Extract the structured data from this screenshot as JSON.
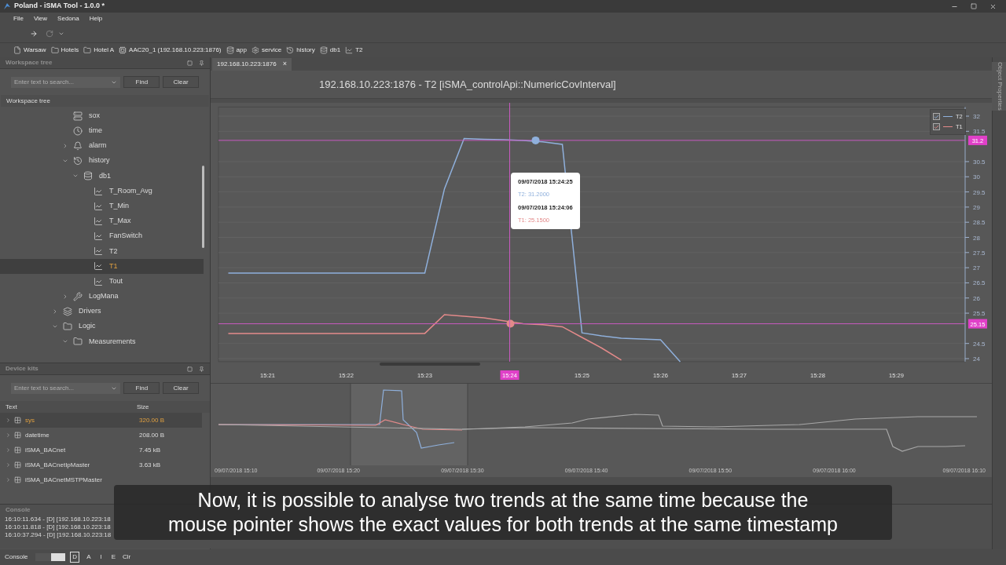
{
  "window": {
    "title": "Poland - iSMA Tool - 1.0.0 *"
  },
  "menu": [
    "File",
    "View",
    "Sedona",
    "Help"
  ],
  "breadcrumb": [
    {
      "label": "Warsaw",
      "kind": "file"
    },
    {
      "label": "Hotels",
      "kind": "folder"
    },
    {
      "label": "Hotel A",
      "kind": "folder"
    },
    {
      "label": "AAC20_1 (192.168.10.223:1876)",
      "kind": "device"
    },
    {
      "label": "app",
      "kind": "database"
    },
    {
      "label": "service",
      "kind": "gear"
    },
    {
      "label": "history",
      "kind": "history"
    },
    {
      "label": "db1",
      "kind": "database"
    },
    {
      "label": "T2",
      "kind": "trend"
    }
  ],
  "workspace": {
    "title": "Workspace tree",
    "search": {
      "placeholder": "Enter text to search..."
    },
    "find": "Find",
    "clear": "Clear",
    "column": "Workspace tree",
    "tree": {
      "continued": [
        {
          "label": "sox",
          "kind": "service",
          "selected": false
        },
        {
          "label": "time",
          "kind": "clock",
          "selected": false
        },
        {
          "label": "alarm",
          "kind": "alarm",
          "expanded": false,
          "selected": false
        },
        {
          "label": "history",
          "kind": "history",
          "expanded": true,
          "selected": false,
          "children": [
            {
              "label": "db1",
              "kind": "database",
              "expanded": true,
              "selected": false,
              "children": [
                {
                  "label": "T_Room_Avg",
                  "kind": "trend",
                  "selected": false
                },
                {
                  "label": "T_Min",
                  "kind": "trend",
                  "selected": false
                },
                {
                  "label": "T_Max",
                  "kind": "trend",
                  "selected": false
                },
                {
                  "label": "FanSwitch",
                  "kind": "trend",
                  "selected": false
                },
                {
                  "label": "T2",
                  "kind": "trend",
                  "selected": false
                },
                {
                  "label": "T1",
                  "kind": "trend",
                  "selected": true
                },
                {
                  "label": "Tout",
                  "kind": "trend",
                  "selected": false
                }
              ]
            }
          ]
        },
        {
          "label": "LogMana",
          "kind": "tool",
          "expanded": false,
          "selected": false
        }
      ],
      "items": [
        {
          "label": "Drivers",
          "kind": "driver",
          "expanded": false,
          "selected": false
        },
        {
          "label": "Logic",
          "kind": "folder",
          "expanded": true,
          "selected": false,
          "children": [
            {
              "label": "Measurements",
              "kind": "folder",
              "expanded": true,
              "selected": false
            }
          ]
        }
      ]
    }
  },
  "device_kits": {
    "title": "Device kits",
    "search": {
      "placeholder": "Enter text to search..."
    },
    "find": "Find",
    "clear": "Clear",
    "columns": [
      "Text",
      "Size"
    ],
    "rows": [
      {
        "text": "sys",
        "size": "320.00 B",
        "selected": true
      },
      {
        "text": "datetime",
        "size": "208.00 B",
        "selected": false
      },
      {
        "text": "iSMA_BACnet",
        "size": "7.45 kB",
        "selected": false
      },
      {
        "text": "iSMA_BACnetIpMaster",
        "size": "3.63 kB",
        "selected": false
      },
      {
        "text": "iSMA_BACnetMSTPMaster",
        "selected": false
      }
    ]
  },
  "console": {
    "title": "Console",
    "lines": [
      "16:10:11.634 - [D] [192.168.10.223:18",
      "16:10:11.818 - [D] [192.168.10.223:18",
      "16:10:37.294 - [D] [192.168.10.223:18"
    ]
  },
  "bottom_bar": {
    "label": "Console",
    "toggle_on": true,
    "filters": [
      {
        "label": "D",
        "selected": true
      },
      {
        "label": "A",
        "selected": false
      },
      {
        "label": "I",
        "selected": false
      },
      {
        "label": "E",
        "selected": false
      }
    ],
    "clear": "Clr"
  },
  "document_tab": {
    "label": "192.168.10.223:1876",
    "close": "×"
  },
  "side_tab": "Object Properties",
  "chart": {
    "title": "192.168.10.223:1876 - T2 [iSMA_controlApi::NumericCovInterval]",
    "legend": [
      {
        "checked": true
      },
      {
        "checked": true
      }
    ],
    "tooltip": [
      {
        "time": "09/07/2018 15:24:25",
        "value": "T2: 31.2000"
      },
      {
        "time": "09/07/2018 15:24:06",
        "value": "T1: 25.1500"
      }
    ],
    "crosshair": {
      "time": "15:24"
    },
    "chart_data": {
      "type": "line",
      "categories": [
        null,
        null,
        "15:21",
        null,
        null,
        null,
        "15:22",
        null,
        null,
        null,
        "15:23",
        null,
        null,
        null,
        null,
        null,
        null,
        null,
        "15:25",
        null,
        null,
        null,
        "15:26",
        null,
        null,
        null,
        "15:27",
        null,
        null,
        null,
        "15:28",
        null,
        null,
        null,
        "15:29",
        null,
        null,
        null
      ],
      "series": [
        {
          "name": "T2",
          "color": "#8fb0dc",
          "values": [
            26.82,
            26.82,
            26.82,
            26.82,
            26.82,
            26.82,
            26.82,
            26.82,
            26.82,
            26.82,
            26.82,
            29.6,
            31.26,
            31.24,
            31.22,
            31.2,
            31.15,
            31.07,
            24.85,
            24.75,
            24.67,
            24.65,
            24.62,
            23.9,
            null,
            null,
            null,
            null,
            null,
            null,
            null,
            null,
            null,
            null,
            null,
            null,
            null,
            null
          ]
        },
        {
          "name": "T1",
          "color": "#e38a8a",
          "values": [
            24.83,
            24.83,
            24.83,
            24.83,
            24.83,
            24.83,
            24.83,
            24.83,
            24.83,
            24.83,
            24.83,
            25.45,
            25.4,
            25.35,
            25.25,
            25.15,
            25.12,
            25.05,
            24.7,
            24.35,
            23.95,
            null,
            null,
            null,
            null,
            null,
            null,
            null,
            null,
            null,
            null,
            null,
            null,
            null,
            null,
            null,
            null,
            null
          ]
        }
      ],
      "ylim": [
        23.9,
        32.3
      ],
      "grid": true,
      "ref_lines": [
        {
          "axis": "y",
          "value": 31.2,
          "label": "31.2",
          "color": "#c85ac0"
        },
        {
          "axis": "y",
          "value": 25.15,
          "label": "25.15",
          "color": "#c85ac0"
        }
      ],
      "yticks": [
        24,
        24.5,
        25.5,
        26,
        26.5,
        27,
        27.5,
        28,
        28.5,
        29,
        29.5,
        30,
        30.5,
        31.5,
        32
      ]
    },
    "overview": {
      "time_labels": [
        "09/07/2018 15:10",
        "09/07/2018 15:20",
        "09/07/2018 15:30",
        "09/07/2018 15:40",
        "09/07/2018 15:50",
        "09/07/2018 16:00",
        "09/07/2018 16:10"
      ]
    }
  },
  "subtitle": [
    "Now, it is possible to analyse two trends at the same time because the",
    "mouse pointer shows the exact values for both trends at the same timestamp"
  ]
}
